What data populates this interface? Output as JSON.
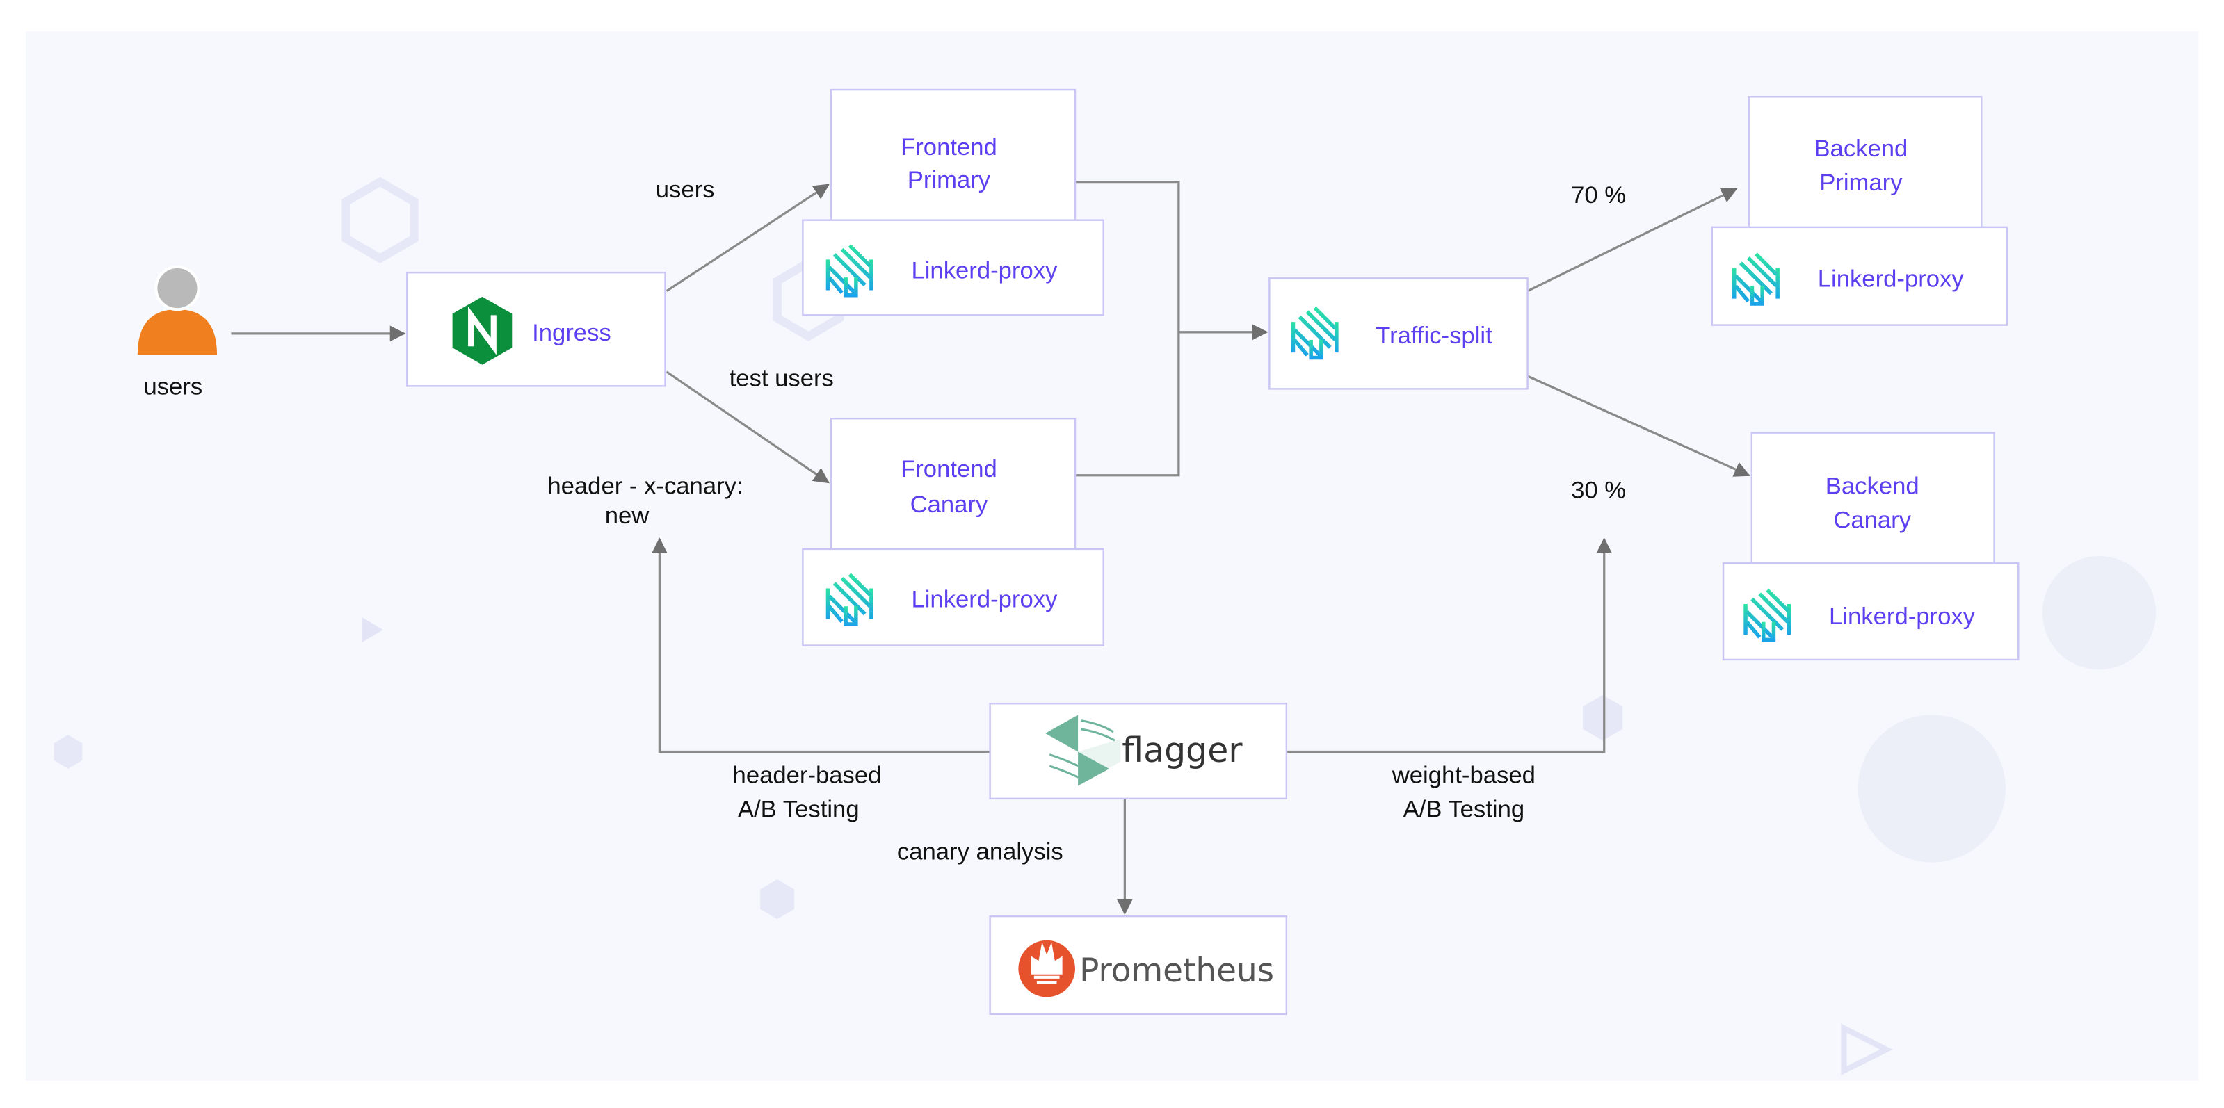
{
  "nodes": {
    "user": "users",
    "ingress": "Ingress",
    "frontend_primary": [
      "Frontend",
      "Primary"
    ],
    "frontend_canary": [
      "Frontend",
      "Canary"
    ],
    "traffic_split": "Traffic-split",
    "backend_primary": [
      "Backend",
      "Primary"
    ],
    "backend_canary": [
      "Backend",
      "Canary"
    ],
    "proxy": "Linkerd-proxy",
    "flagger": "flagger",
    "prometheus": "Prometheus"
  },
  "edges": {
    "users": "users",
    "test_users": "test users",
    "header_rule": [
      "header - x-canary:",
      "new"
    ],
    "weight_primary": "70 %",
    "weight_canary": "30 %",
    "header_based": [
      "header-based",
      "A/B Testing"
    ],
    "weight_based": [
      "weight-based",
      "A/B Testing"
    ],
    "canary_analysis": "canary analysis"
  },
  "colors": {
    "background": "#f7f8fd",
    "node_text": "#5b3ff0",
    "box_border": "#c9c6f5",
    "user_body": "#f0801f",
    "nginx": "#0b8f3c",
    "linkerd_start": "#2de2a4",
    "linkerd_end": "#1aa3e8",
    "flagger": "#6fb59c",
    "prometheus": "#e6522c"
  }
}
